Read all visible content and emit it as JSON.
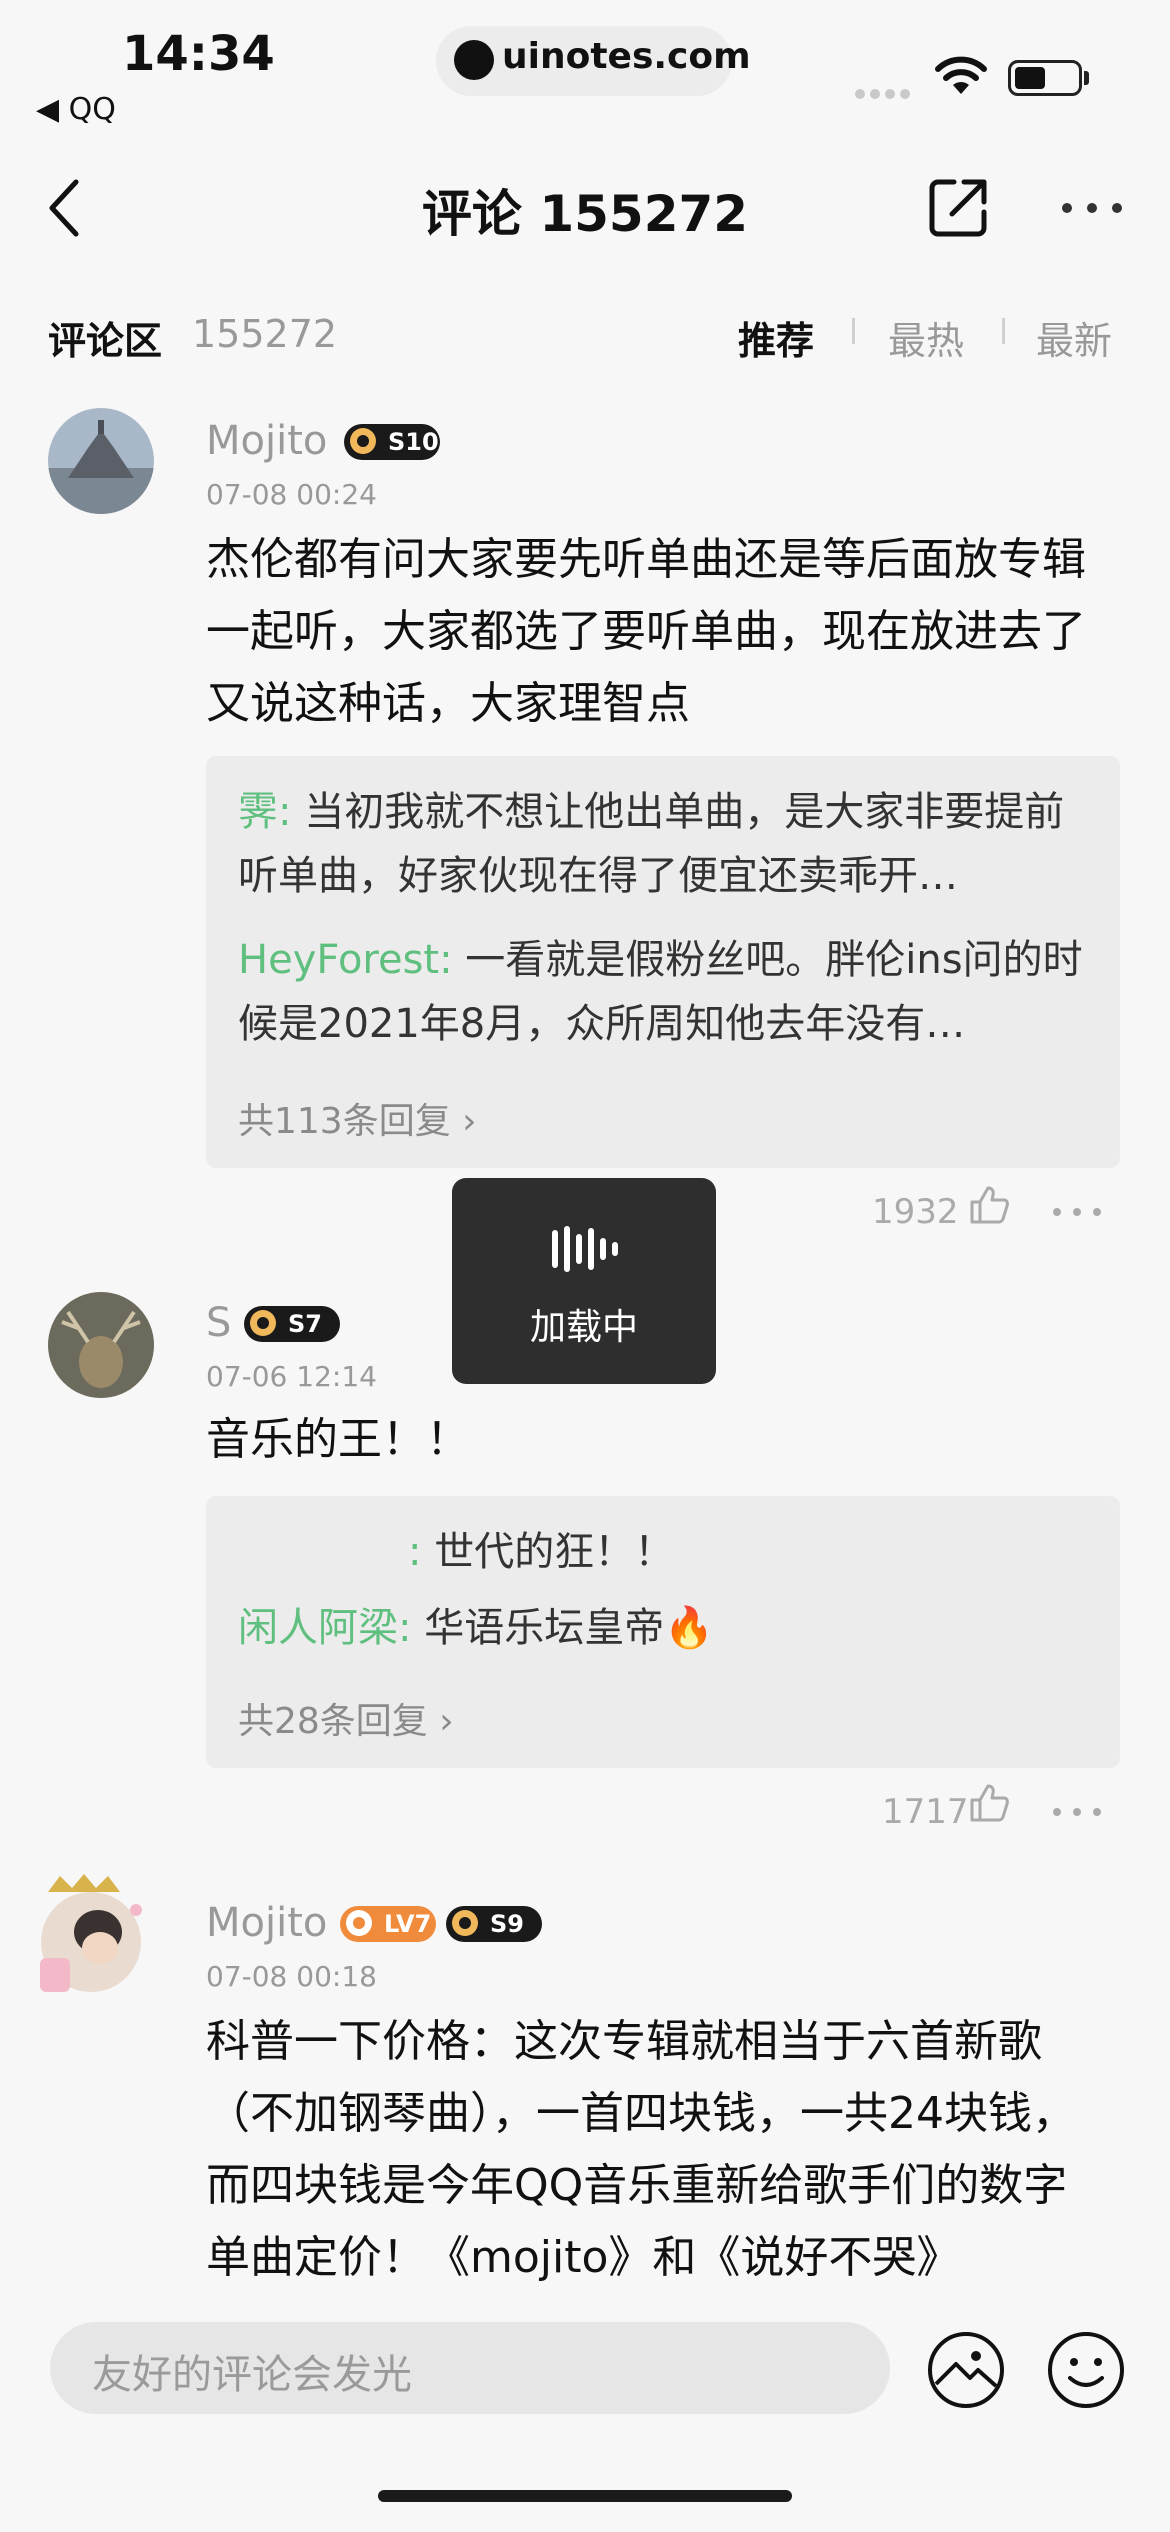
{
  "status_bar": {
    "time": "14:34",
    "back_app": "◀ QQ",
    "url": "uinotes.com"
  },
  "nav": {
    "title": "评论 155272"
  },
  "section": {
    "title": "评论区",
    "count": "155272",
    "sort_tabs": [
      "推荐",
      "最热",
      "最新"
    ]
  },
  "comments": [
    {
      "user": "Mojito",
      "badges": [
        "S10"
      ],
      "time": "07-08 00:24",
      "text": "杰伦都有问大家要先听单曲还是等后面放专辑一起听，大家都选了要听单曲，现在放进去了又说这种话，大家理智点",
      "replies": [
        {
          "user": "霁:",
          "text": " 当初我就不想让他出单曲，是大家非要提前听单曲，好家伙现在得了便宜还卖乖开…"
        },
        {
          "user": "HeyForest:",
          "text": " 一看就是假粉丝吧。胖伦ins问的时候是2021年8月，众所周知他去年没有…"
        }
      ],
      "more_replies": "共113条回复 ›",
      "likes": "1932"
    },
    {
      "user": "S",
      "badges": [
        "S7"
      ],
      "time": "07-06 12:14",
      "text": "音乐的王！！",
      "replies": [
        {
          "user": ":",
          "text": " 世代的狂！！"
        },
        {
          "user": "闲人阿梁:",
          "text": " 华语乐坛皇帝🔥"
        }
      ],
      "more_replies": "共28条回复 ›",
      "likes": "1717"
    },
    {
      "user": "Mojito",
      "badges": [
        "LV7",
        "S9"
      ],
      "time": "07-08 00:18",
      "text": "科普一下价格：这次专辑就相当于六首新歌（不加钢琴曲），一首四块钱，一共24块钱，而四块钱是今年QQ音乐重新给歌手们的数字单曲定价！《mojito》和《说好不哭》"
    }
  ],
  "loading_toast": {
    "label": "加载中"
  },
  "bottom": {
    "input_placeholder": "友好的评论会发光"
  },
  "colors": {
    "reply_user": "#5fbf7f",
    "badge_dark": "#1a1a1a",
    "badge_lv": "#f08b3c"
  }
}
